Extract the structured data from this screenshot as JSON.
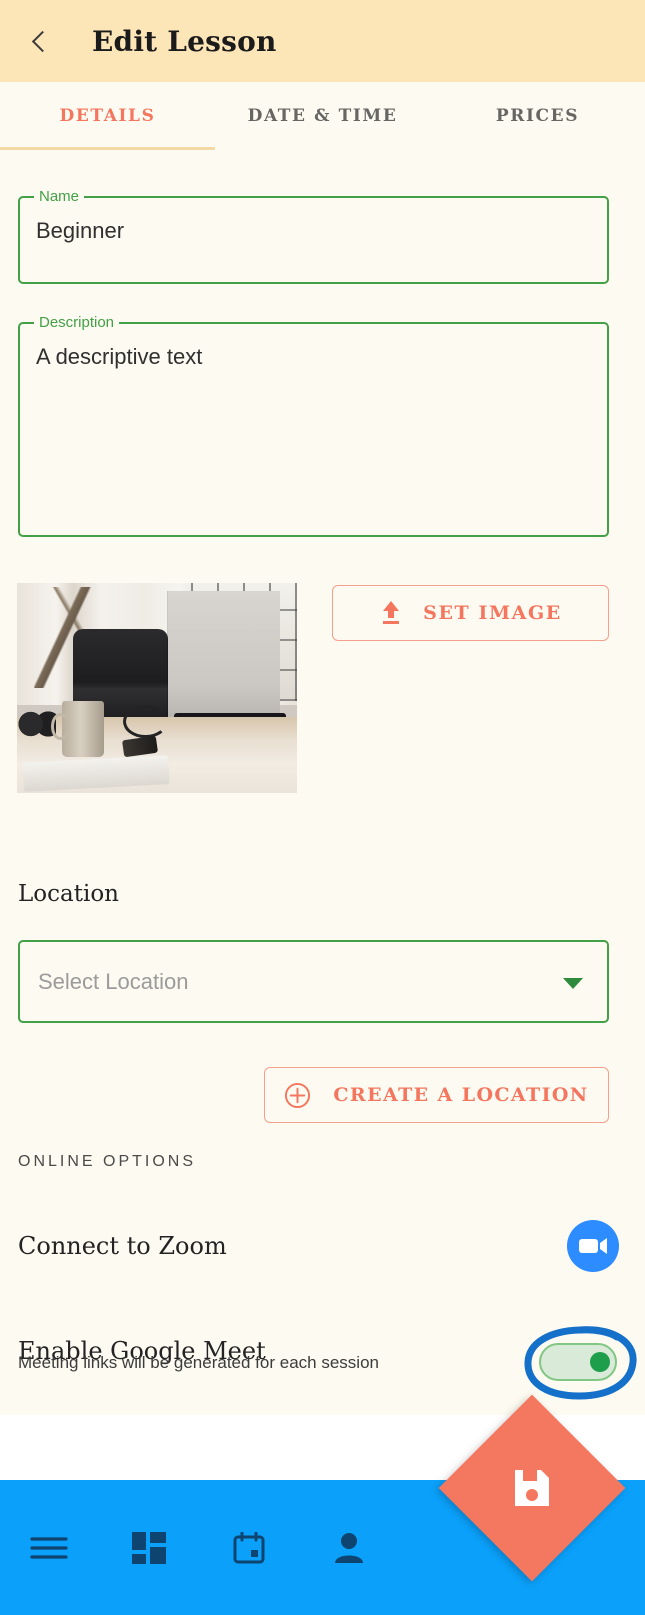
{
  "header": {
    "back_icon": "chevron-left-icon",
    "title": "Edit Lesson"
  },
  "tabs": [
    {
      "label": "DETAILS",
      "active": true
    },
    {
      "label": "DATE & TIME",
      "active": false
    },
    {
      "label": "PRICES",
      "active": false
    }
  ],
  "form": {
    "name": {
      "label": "Name",
      "value": "Beginner"
    },
    "description": {
      "label": "Description",
      "value": "A descriptive text"
    },
    "set_image": {
      "label": "SET IMAGE",
      "icon": "upload-icon"
    },
    "image_thumbnail_alt": "desk workspace photo"
  },
  "location": {
    "heading": "Location",
    "select_placeholder": "Select Location",
    "caret_icon": "chevron-down-icon",
    "create_button": {
      "label": "CREATE A LOCATION",
      "icon": "plus-circle-icon"
    }
  },
  "online_options": {
    "section_title": "ONLINE OPTIONS",
    "zoom": {
      "title": "Connect to Zoom",
      "icon": "zoom-video-icon"
    },
    "google_meet": {
      "title": "Enable Google Meet",
      "subtitle": "Meeting links will be generated for each session",
      "toggle_state": "on"
    }
  },
  "bottom_nav": {
    "items": [
      {
        "icon": "hamburger-menu-icon"
      },
      {
        "icon": "dashboard-grid-icon"
      },
      {
        "icon": "calendar-icon"
      },
      {
        "icon": "person-icon"
      }
    ],
    "fab": {
      "icon": "save-icon"
    }
  },
  "colors": {
    "header_bg": "#fce5b7",
    "page_bg": "#fdfaf1",
    "accent_coral": "#f4765e",
    "field_green": "#43a047",
    "nav_blue": "#0ba0fa",
    "nav_icon": "#0d4470",
    "zoom_blue": "#2d8cff",
    "annotation_blue": "#1470c8",
    "toggle_green": "#1e9e4a"
  }
}
